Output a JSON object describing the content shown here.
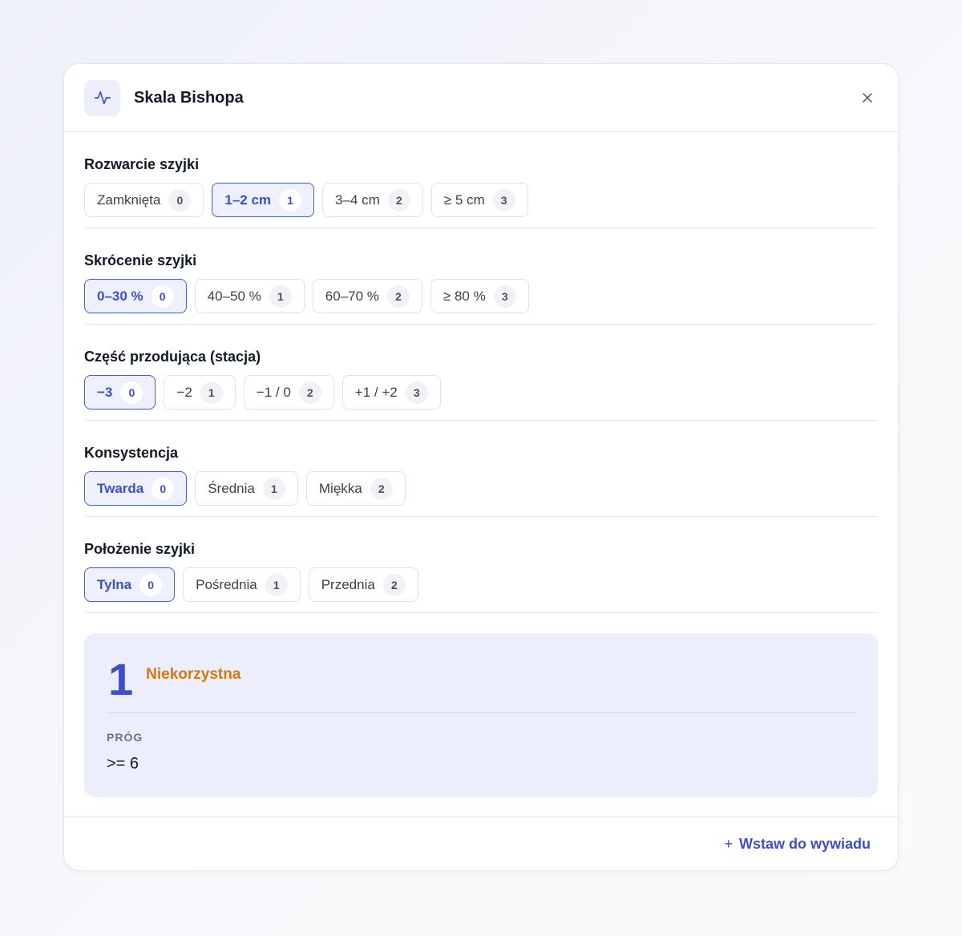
{
  "header": {
    "title": "Skala Bishopa",
    "icon": "activity-icon",
    "close_icon": "close-icon"
  },
  "sections": [
    {
      "label": "Rozwarcie szyjki",
      "options": [
        {
          "label": "Zamknięta",
          "score": "0",
          "selected": false
        },
        {
          "label": "1–2 cm",
          "score": "1",
          "selected": true
        },
        {
          "label": "3–4 cm",
          "score": "2",
          "selected": false
        },
        {
          "label": "≥ 5 cm",
          "score": "3",
          "selected": false
        }
      ]
    },
    {
      "label": "Skrócenie szyjki",
      "options": [
        {
          "label": "0–30 %",
          "score": "0",
          "selected": true
        },
        {
          "label": "40–50 %",
          "score": "1",
          "selected": false
        },
        {
          "label": "60–70 %",
          "score": "2",
          "selected": false
        },
        {
          "label": "≥ 80 %",
          "score": "3",
          "selected": false
        }
      ]
    },
    {
      "label": "Część przodująca (stacja)",
      "options": [
        {
          "label": "−3",
          "score": "0",
          "selected": true
        },
        {
          "label": "−2",
          "score": "1",
          "selected": false
        },
        {
          "label": "−1 / 0",
          "score": "2",
          "selected": false
        },
        {
          "label": "+1 / +2",
          "score": "3",
          "selected": false
        }
      ]
    },
    {
      "label": "Konsystencja",
      "options": [
        {
          "label": "Twarda",
          "score": "0",
          "selected": true
        },
        {
          "label": "Średnia",
          "score": "1",
          "selected": false
        },
        {
          "label": "Miękka",
          "score": "2",
          "selected": false
        }
      ]
    },
    {
      "label": "Położenie szyjki",
      "options": [
        {
          "label": "Tylna",
          "score": "0",
          "selected": true
        },
        {
          "label": "Pośrednia",
          "score": "1",
          "selected": false
        },
        {
          "label": "Przednia",
          "score": "2",
          "selected": false
        }
      ]
    }
  ],
  "result": {
    "score": "1",
    "verdict": "Niekorzystna",
    "threshold_label": "PRÓG",
    "threshold_value": ">= 6"
  },
  "footer": {
    "insert_label": "Wstaw do wywiadu",
    "insert_icon": "plus-icon"
  },
  "colors": {
    "accent": "#3d4fc6",
    "verdict": "#d97806",
    "result_bg": "#eceefb"
  }
}
